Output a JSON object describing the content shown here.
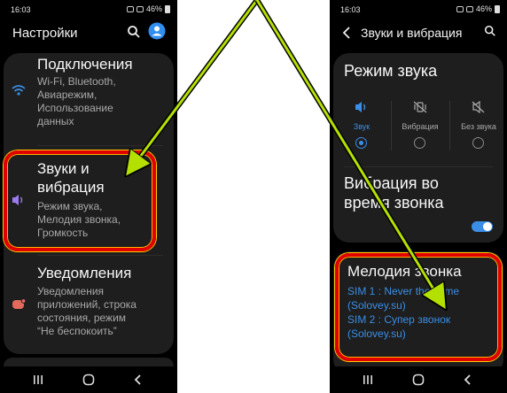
{
  "left": {
    "status": {
      "time": "16:03",
      "battery": "46%"
    },
    "header": {
      "title": "Настройки"
    },
    "items": [
      {
        "title": "Подключения",
        "subtitle": [
          "Wi-Fi, Bluetooth,",
          "Авиарежим,",
          "Использование",
          "данных"
        ],
        "icon": "wifi-icon"
      },
      {
        "title": [
          "Звуки и",
          "вибрация"
        ],
        "subtitle": [
          "Режим звука,",
          "Мелодия звонка,",
          "Громкость"
        ],
        "icon": "sound-icon"
      },
      {
        "title": "Уведомления",
        "subtitle": [
          "Уведомления",
          "приложений, строка",
          "состояния, режим",
          "“Не беспокоить”"
        ],
        "icon": "notifications-icon"
      }
    ]
  },
  "right": {
    "status": {
      "time": "16:03",
      "battery": "46%"
    },
    "header": {
      "title": "Звуки и вибрация"
    },
    "sound_mode": {
      "title": "Режим звука",
      "options": [
        {
          "label": "Звук",
          "selected": true,
          "icon": "speaker-icon"
        },
        {
          "label": "Вибрация",
          "selected": false,
          "icon": "vibrate-icon"
        },
        {
          "label": "Без звука",
          "selected": false,
          "icon": "mute-icon"
        }
      ]
    },
    "vibration_during_call": {
      "title": [
        "Вибрация во",
        "время звонка"
      ],
      "enabled": true
    },
    "ringtone": {
      "title": "Мелодия звонка",
      "sim1": [
        "SIM 1 : Never the same",
        "(Solovey.su)"
      ],
      "sim2": [
        "SIM 2 : Супер звонок",
        "(Solovey.su)"
      ]
    }
  },
  "colors": {
    "accent": "#3a8ee6",
    "highlight": "#e00000",
    "arrow": "#b4e000"
  }
}
